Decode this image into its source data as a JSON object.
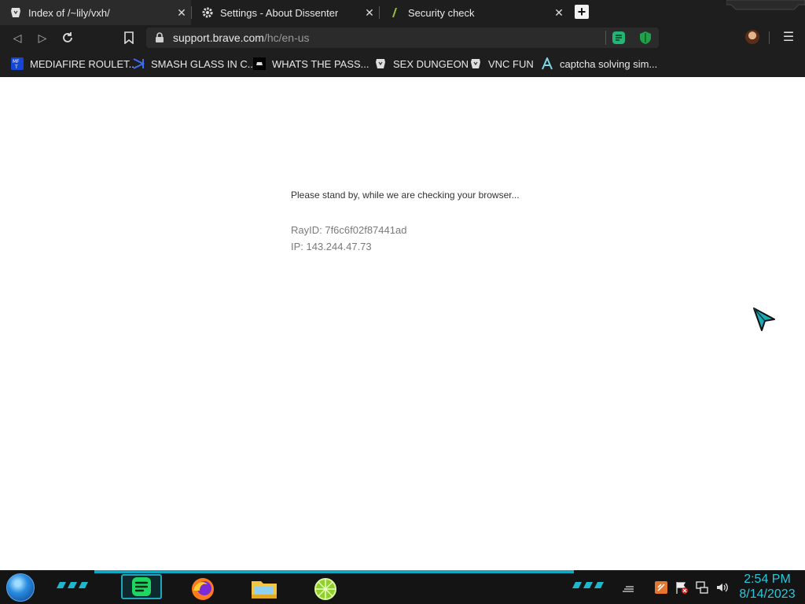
{
  "tabs": [
    {
      "title": "Index of /~lily/vxh/",
      "favicon": "brave-lion-icon",
      "active": true
    },
    {
      "title": "Settings - About Dissenter",
      "favicon": "gear-icon",
      "active": false
    },
    {
      "title": "Security check",
      "favicon": "leaf-icon",
      "active": false
    }
  ],
  "toolbar": {
    "url_host": "support.brave.com",
    "url_path": "/hc/en-us"
  },
  "bookmarks": [
    {
      "label": "MEDIAFIRE ROULET...",
      "icon": "mediafire-icon"
    },
    {
      "label": "SMASH GLASS IN C...",
      "icon": "vscode-icon"
    },
    {
      "label": "WHATS THE PASS...",
      "icon": "site-icon"
    },
    {
      "label": "SEX DUNGEON",
      "icon": "brave-lion-icon"
    },
    {
      "label": "VNC FUN",
      "icon": "brave-lion-icon"
    },
    {
      "label": "captcha solving sim...",
      "icon": "arrow-logo-icon"
    }
  ],
  "page": {
    "standby_text": "Please stand by, while we are checking your browser...",
    "ray_id": "RayID: 7f6c6f02f87441ad",
    "ip": "IP: 143.244.47.73"
  },
  "taskbar": {
    "time": "2:54 PM",
    "date": "8/14/2023"
  },
  "colors": {
    "chrome_bg": "#1e1e1e",
    "accent": "#27c8dc",
    "extension_green": "#22b573"
  }
}
